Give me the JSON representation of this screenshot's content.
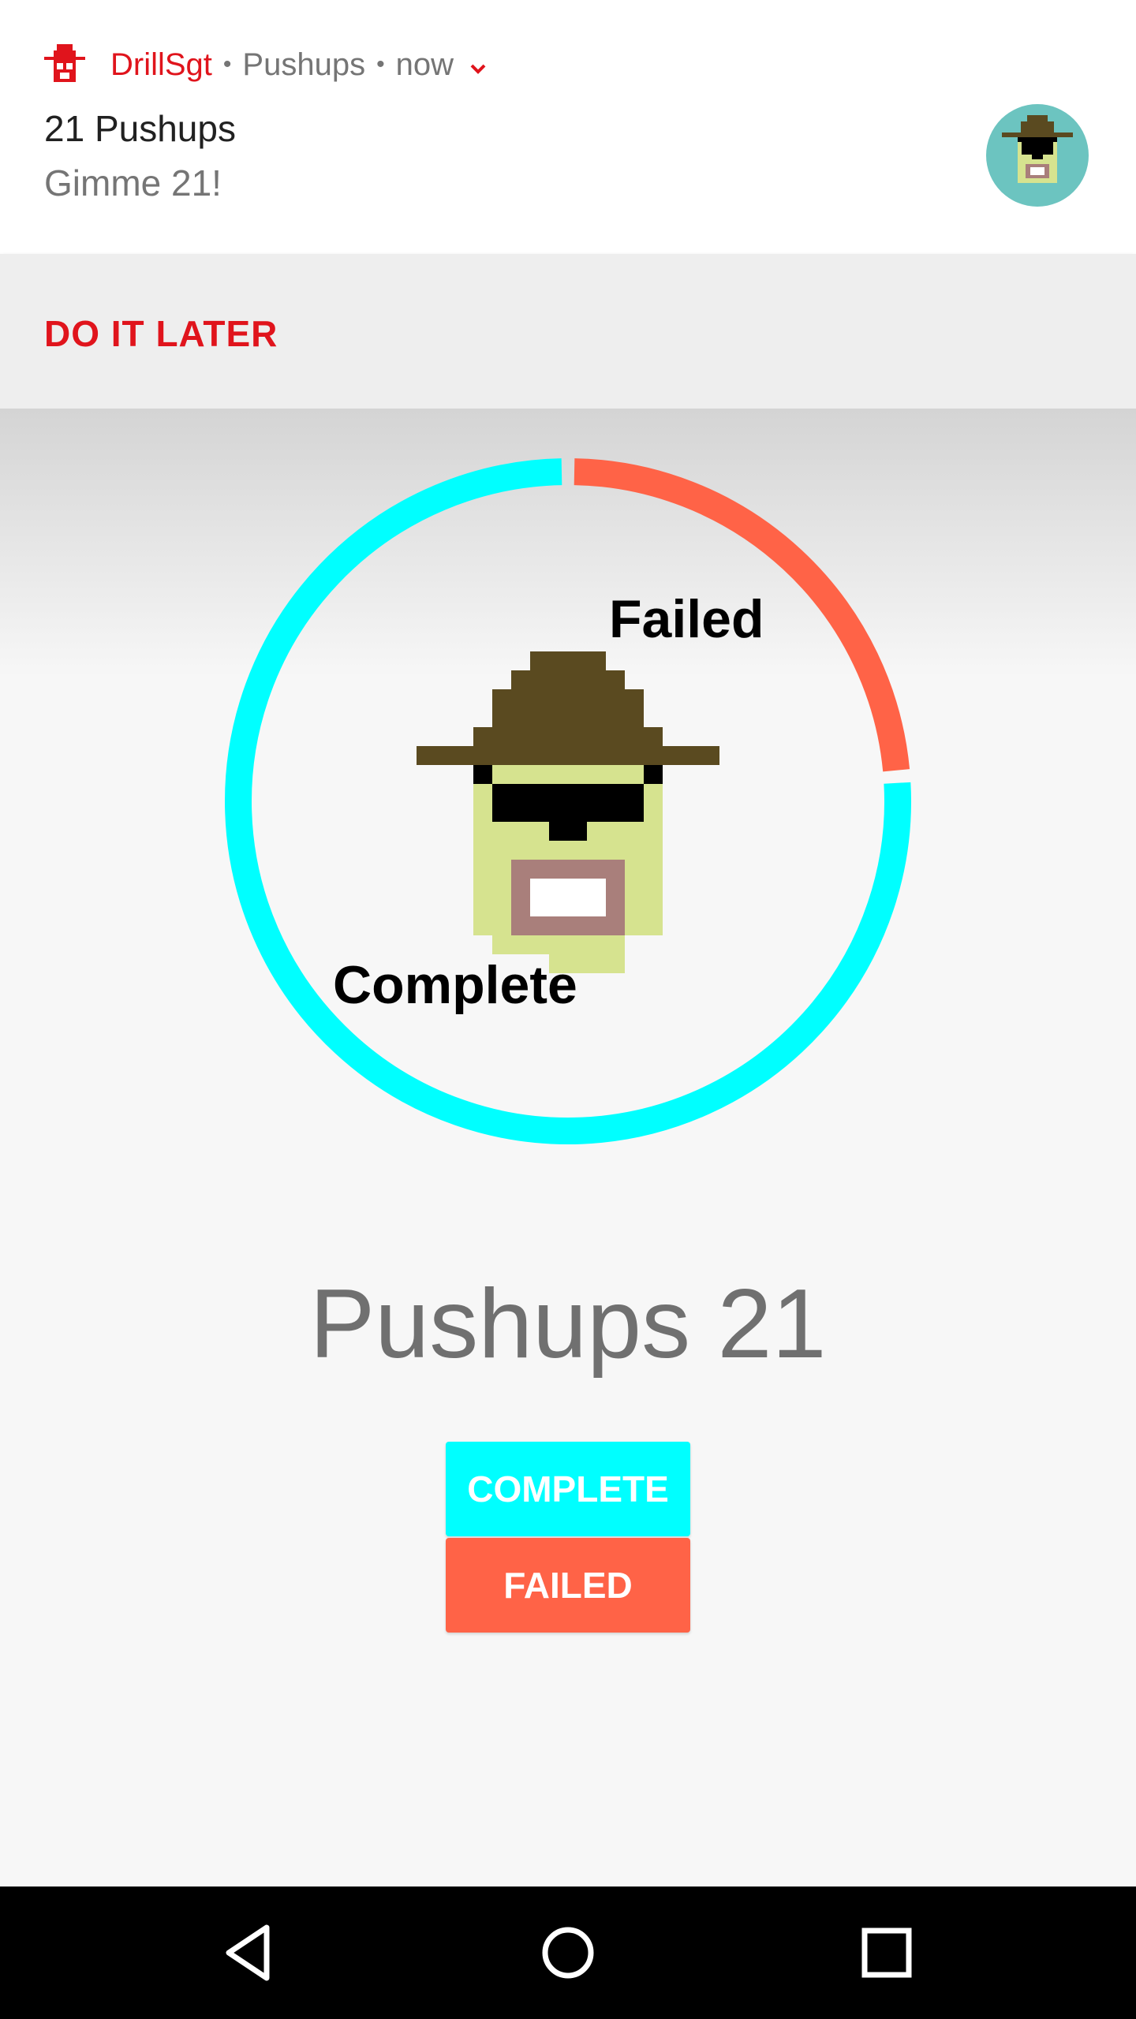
{
  "notification": {
    "app_name": "DrillSgt",
    "channel": "Pushups",
    "time": "now",
    "title": "21 Pushups",
    "text": "Gimme 21!",
    "accent_color": "#e0141c",
    "action_label": "DO IT LATER",
    "app_icon": "drill-sergeant-hat-icon",
    "expand_icon": "chevron-down-icon"
  },
  "chart_data": {
    "type": "pie",
    "style": "donut",
    "categories": [
      "Failed",
      "Complete"
    ],
    "values": [
      5,
      16
    ],
    "colors": [
      "#ff6347",
      "#00ffff"
    ],
    "labels": {
      "failed": "Failed",
      "complete": "Complete"
    }
  },
  "main": {
    "title": "Pushups 21",
    "complete_label": "COMPLETE",
    "failed_label": "FAILED",
    "complete_color": "#00ffff",
    "failed_color": "#ff6347"
  },
  "navbar": {
    "back_icon": "back-triangle-icon",
    "home_icon": "home-circle-icon",
    "recents_icon": "recents-square-icon"
  }
}
